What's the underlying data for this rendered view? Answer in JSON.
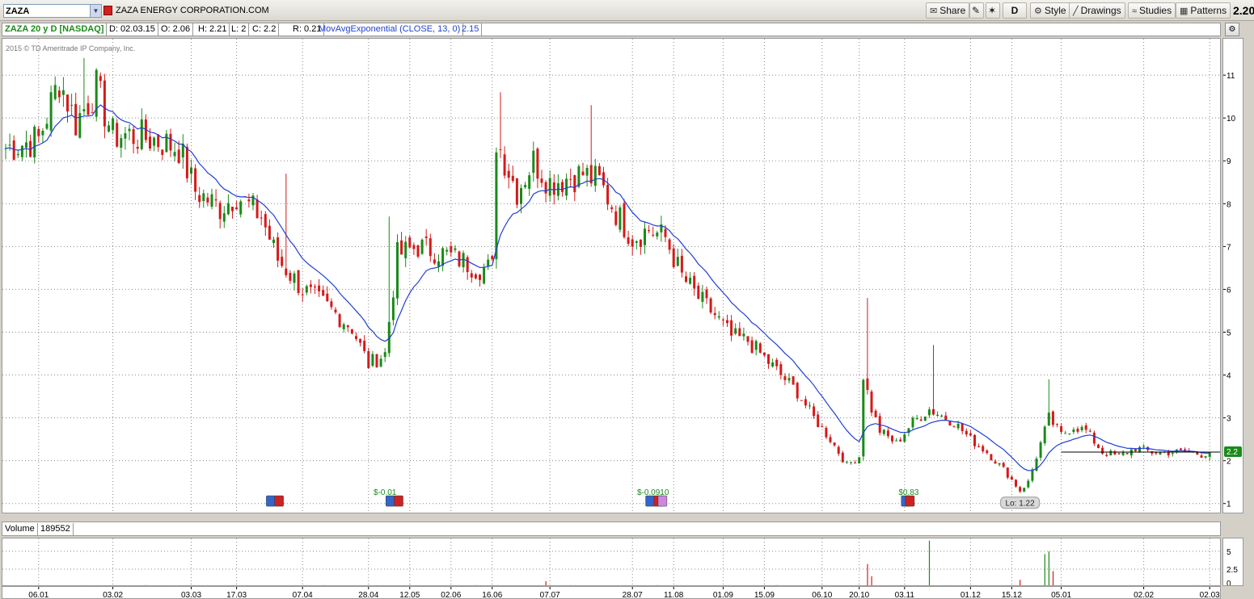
{
  "toolbar": {
    "symbol": "ZAZA",
    "company": "ZAZA ENERGY CORPORATION.COM",
    "share": "Share",
    "d_label": "D",
    "style": "Style",
    "drawings": "Drawings",
    "studies": "Studies",
    "patterns": "Patterns",
    "last_price": "2.20"
  },
  "info": {
    "title": "ZAZA 20 y D [NASDAQ]",
    "date": "D: 02.03.15",
    "open": "O: 2.06",
    "high": "H: 2.21",
    "low": "L: 2",
    "close": "C: 2.2",
    "range": "R: 0.21",
    "study": "MovAvgExponential (CLOSE, 13, 0)",
    "study_value": "2.15"
  },
  "copyright": "2015 © TD Ameritrade IP Company, Inc.",
  "volume_label": "Volume",
  "volume_value": "189552",
  "last_tag": "2.2",
  "low_tag": "Lo: 1.22",
  "dividends": [
    "$-0.01",
    "$-0.0910",
    "$0.83"
  ],
  "colors": {
    "up": "#1a8a1a",
    "down": "#d41a1a",
    "ema": "#1f3fd6",
    "grid": "#888888"
  },
  "chart_data": {
    "type": "candlestick",
    "y_ticks": [
      1,
      2,
      3,
      4,
      5,
      6,
      7,
      8,
      9,
      10,
      11
    ],
    "ylim": [
      0.75,
      11.85
    ],
    "vol_ticks": [
      "5",
      "2.5",
      "0"
    ],
    "x_labels": [
      "06.01",
      "03.02",
      "03.03",
      "17.03",
      "07.04",
      "28.04",
      "12.05",
      "02.06",
      "16.06",
      "07.07",
      "28.07",
      "11.08",
      "01.09",
      "15.09",
      "06.10",
      "20.10",
      "03.11",
      "01.12",
      "15.12",
      "05.01",
      "02.02",
      "02.03"
    ],
    "close_path": [
      [
        0,
        9.3
      ],
      [
        8,
        9.5
      ],
      [
        13,
        10.9
      ],
      [
        17,
        9.9
      ],
      [
        22,
        10.7
      ],
      [
        26,
        9.6
      ],
      [
        30,
        9.6
      ],
      [
        36,
        9.5
      ],
      [
        42,
        9.3
      ],
      [
        46,
        8.3
      ],
      [
        52,
        7.9
      ],
      [
        56,
        8.2
      ],
      [
        62,
        7.7
      ],
      [
        66,
        6.7
      ],
      [
        72,
        6.0
      ],
      [
        78,
        5.6
      ],
      [
        84,
        5.1
      ],
      [
        88,
        4.25
      ],
      [
        92,
        4.5
      ],
      [
        95,
        6.8
      ],
      [
        100,
        7.0
      ],
      [
        104,
        6.9
      ],
      [
        110,
        6.7
      ],
      [
        114,
        6.5
      ],
      [
        118,
        6.5
      ],
      [
        119,
        9.5
      ],
      [
        124,
        8.3
      ],
      [
        128,
        9.0
      ],
      [
        132,
        8.5
      ],
      [
        136,
        8.6
      ],
      [
        140,
        8.7
      ],
      [
        144,
        8.5
      ],
      [
        148,
        7.8
      ],
      [
        152,
        7.2
      ],
      [
        156,
        7.4
      ],
      [
        160,
        7.2
      ],
      [
        164,
        6.3
      ],
      [
        168,
        5.8
      ],
      [
        172,
        5.4
      ],
      [
        176,
        4.9
      ],
      [
        180,
        4.8
      ],
      [
        184,
        4.4
      ],
      [
        188,
        4.0
      ],
      [
        192,
        3.6
      ],
      [
        196,
        3.0
      ],
      [
        200,
        2.5
      ],
      [
        204,
        1.9
      ],
      [
        207,
        2.1
      ],
      [
        208,
        4.0
      ],
      [
        210,
        3.2
      ],
      [
        212,
        2.7
      ],
      [
        216,
        2.4
      ],
      [
        220,
        2.9
      ],
      [
        224,
        3.2
      ],
      [
        230,
        2.9
      ],
      [
        234,
        2.5
      ],
      [
        238,
        2.2
      ],
      [
        242,
        1.8
      ],
      [
        246,
        1.3
      ],
      [
        248,
        1.5
      ],
      [
        250,
        2.1
      ],
      [
        253,
        3.0
      ],
      [
        256,
        2.6
      ],
      [
        259,
        2.8
      ],
      [
        262,
        2.7
      ],
      [
        266,
        2.2
      ],
      [
        270,
        2.1
      ],
      [
        274,
        2.3
      ],
      [
        278,
        2.2
      ],
      [
        282,
        2.2
      ],
      [
        286,
        2.2
      ],
      [
        290,
        2.15
      ],
      [
        292,
        2.2
      ]
    ],
    "spikes": [
      [
        19,
        11.4
      ],
      [
        68,
        8.7
      ],
      [
        93,
        7.7
      ],
      [
        120,
        10.6
      ],
      [
        142,
        10.3
      ],
      [
        209,
        5.8
      ],
      [
        225,
        4.7
      ],
      [
        253,
        3.9
      ]
    ],
    "ema_period": 13,
    "last_close": 2.2,
    "low_marker": 1.22,
    "volume_spikes": [
      [
        131,
        0.8
      ],
      [
        209,
        3.2
      ],
      [
        210,
        1.5
      ],
      [
        224,
        6.5
      ],
      [
        246,
        1.0
      ],
      [
        252,
        4.6
      ],
      [
        253,
        5.0
      ],
      [
        254,
        2.2
      ]
    ]
  }
}
